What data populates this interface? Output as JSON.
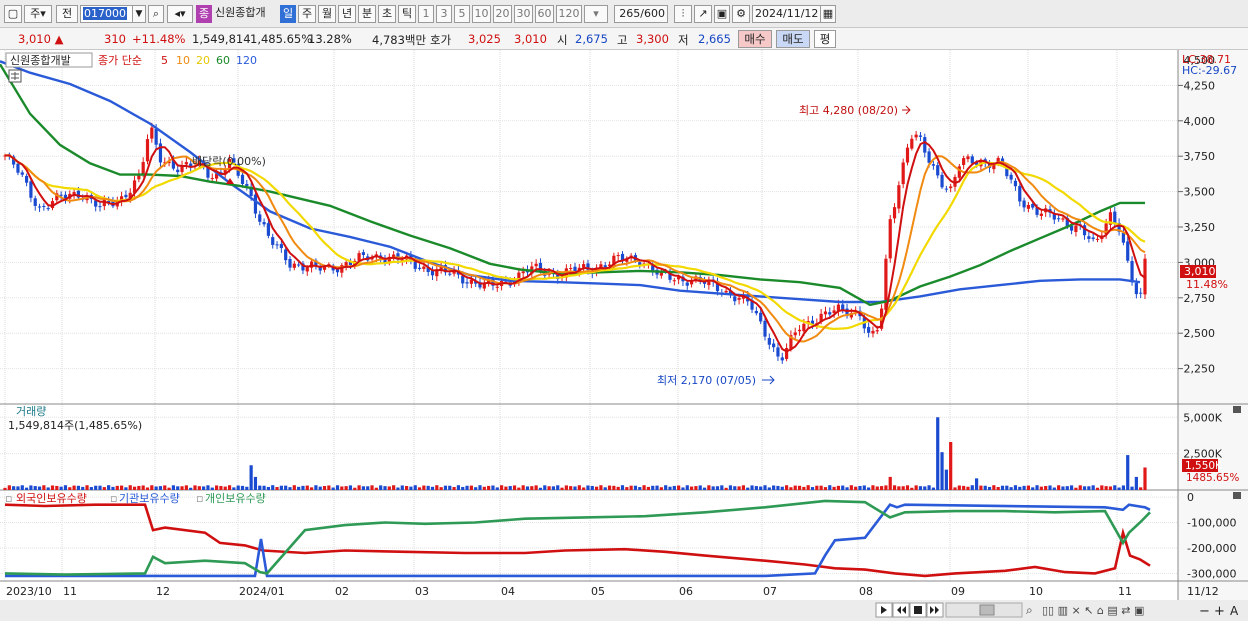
{
  "toolbar": {
    "mode_label": "주",
    "prev_label": "전",
    "code": "017000",
    "stock_name": "신원종합개",
    "period_tabs": [
      "일",
      "주",
      "월",
      "년",
      "분",
      "초",
      "틱"
    ],
    "intervals": [
      "1",
      "3",
      "5",
      "10",
      "20",
      "30",
      "60",
      "120"
    ],
    "count": "265",
    "count_max": "/600",
    "date": "2024/11/12",
    "jong_label": "종"
  },
  "quote": {
    "price": "3,010",
    "change": "310",
    "change_pct": "+11.48%",
    "volume": "1,549,814",
    "volume_pct": "1,485.65%",
    "turnover": "13.28%",
    "amount": "4,783백만",
    "hoga_label": "호가",
    "hoga_ask": "3,025",
    "hoga_bid": "3,010",
    "open_label": "시",
    "open": "2,675",
    "high_label": "고",
    "high": "3,300",
    "low_label": "저",
    "low": "2,665",
    "buy_label": "매수",
    "sell_label": "매도",
    "avg_label": "평"
  },
  "chart_data": [
    {
      "type": "candlestick",
      "title": "신원종합개발",
      "legend": {
        "label": "종가 단순",
        "items": [
          "5",
          "10",
          "20",
          "60",
          "120"
        ],
        "colors": [
          "#d01010",
          "#f08a10",
          "#f2d900",
          "#1a8a2a",
          "#2a5ad8"
        ]
      },
      "ylim": [
        2000,
        4500
      ],
      "yticks": [
        "2,250",
        "2,500",
        "2,750",
        "3,000",
        "3,250",
        "3,500",
        "3,750",
        "4,000",
        "4,250"
      ],
      "y_top_label": "4,500",
      "lc": "LC:38.71",
      "hc": "HC:-29.67",
      "current_price": "3,010",
      "current_pct": "11.48%",
      "annotations": {
        "high": "최고 4,280 (08/20)",
        "low": "최저 2,170 (07/05)",
        "dividend": "배당락(0.00%)"
      },
      "ma120": [
        [
          0,
          4420
        ],
        [
          30,
          4340
        ],
        [
          70,
          4260
        ],
        [
          110,
          4140
        ],
        [
          150,
          3980
        ],
        [
          190,
          3780
        ],
        [
          230,
          3560
        ],
        [
          270,
          3360
        ],
        [
          310,
          3240
        ],
        [
          350,
          3180
        ],
        [
          390,
          3110
        ],
        [
          430,
          3000
        ],
        [
          470,
          2910
        ],
        [
          510,
          2870
        ],
        [
          560,
          2860
        ],
        [
          600,
          2850
        ],
        [
          640,
          2840
        ],
        [
          680,
          2800
        ],
        [
          720,
          2780
        ],
        [
          760,
          2760
        ],
        [
          800,
          2740
        ],
        [
          840,
          2720
        ],
        [
          880,
          2720
        ],
        [
          920,
          2760
        ],
        [
          960,
          2810
        ],
        [
          1000,
          2840
        ],
        [
          1040,
          2870
        ],
        [
          1080,
          2880
        ],
        [
          1100,
          2880
        ],
        [
          1120,
          2880
        ],
        [
          1140,
          2860
        ]
      ],
      "ma60": [
        [
          0,
          4400
        ],
        [
          30,
          4050
        ],
        [
          60,
          3830
        ],
        [
          90,
          3700
        ],
        [
          120,
          3620
        ],
        [
          150,
          3620
        ],
        [
          180,
          3610
        ],
        [
          210,
          3570
        ],
        [
          240,
          3540
        ],
        [
          270,
          3500
        ],
        [
          300,
          3450
        ],
        [
          330,
          3400
        ],
        [
          370,
          3290
        ],
        [
          410,
          3190
        ],
        [
          450,
          3100
        ],
        [
          490,
          2990
        ],
        [
          520,
          2950
        ],
        [
          560,
          2920
        ],
        [
          600,
          2930
        ],
        [
          640,
          2940
        ],
        [
          680,
          2930
        ],
        [
          720,
          2910
        ],
        [
          760,
          2880
        ],
        [
          800,
          2860
        ],
        [
          840,
          2820
        ],
        [
          870,
          2700
        ],
        [
          890,
          2730
        ],
        [
          920,
          2830
        ],
        [
          950,
          2900
        ],
        [
          980,
          2980
        ],
        [
          1010,
          3080
        ],
        [
          1040,
          3170
        ],
        [
          1070,
          3260
        ],
        [
          1100,
          3360
        ],
        [
          1120,
          3420
        ],
        [
          1145,
          3420
        ]
      ]
    },
    {
      "type": "bar",
      "title": "거래량",
      "summary": "1,549,814주(1,485.65%)",
      "ylim": [
        0,
        5500000
      ],
      "yticks": [
        "2,500K",
        "5,000K"
      ],
      "current": "1,550K",
      "current_pct": "1485.65%"
    },
    {
      "type": "line",
      "legend": [
        "외국인보유수량",
        "기관보유수량",
        "개인보유수량"
      ],
      "colors": [
        "#d01010",
        "#2a5ad8",
        "#2e9a55"
      ],
      "ylim": [
        -330000,
        20000
      ],
      "yticks": [
        "0",
        "-100,000",
        "-200,000",
        "-300,000"
      ],
      "series": [
        {
          "name": "외국인보유수량",
          "points": [
            [
              0,
              -30000
            ],
            [
              40,
              -35000
            ],
            [
              90,
              -30000
            ],
            [
              140,
              -30000
            ],
            [
              148,
              -130000
            ],
            [
              160,
              -120000
            ],
            [
              200,
              -140000
            ],
            [
              215,
              -180000
            ],
            [
              240,
              -190000
            ],
            [
              258,
              -210000
            ],
            [
              300,
              -220000
            ],
            [
              340,
              -210000
            ],
            [
              400,
              -215000
            ],
            [
              460,
              -220000
            ],
            [
              520,
              -220000
            ],
            [
              560,
              -210000
            ],
            [
              620,
              -205000
            ],
            [
              660,
              -215000
            ],
            [
              700,
              -230000
            ],
            [
              760,
              -250000
            ],
            [
              800,
              -265000
            ],
            [
              830,
              -280000
            ],
            [
              860,
              -285000
            ],
            [
              890,
              -300000
            ],
            [
              920,
              -310000
            ],
            [
              950,
              -300000
            ],
            [
              1000,
              -290000
            ],
            [
              1030,
              -275000
            ],
            [
              1060,
              -295000
            ],
            [
              1090,
              -300000
            ],
            [
              1110,
              -280000
            ],
            [
              1118,
              -140000
            ],
            [
              1125,
              -230000
            ],
            [
              1135,
              -245000
            ],
            [
              1145,
              -270000
            ]
          ]
        },
        {
          "name": "기관보유수량",
          "points": [
            [
              0,
              -310000
            ],
            [
              250,
              -310000
            ],
            [
              256,
              -165000
            ],
            [
              262,
              -310000
            ],
            [
              500,
              -310000
            ],
            [
              600,
              -310000
            ],
            [
              760,
              -310000
            ],
            [
              810,
              -300000
            ],
            [
              820,
              -230000
            ],
            [
              830,
              -170000
            ],
            [
              860,
              -160000
            ],
            [
              885,
              -30000
            ],
            [
              892,
              -40000
            ],
            [
              900,
              -30000
            ],
            [
              1100,
              -40000
            ],
            [
              1118,
              -50000
            ],
            [
              1124,
              -30000
            ],
            [
              1140,
              -40000
            ],
            [
              1145,
              -50000
            ]
          ]
        },
        {
          "name": "개인보유수량",
          "points": [
            [
              0,
              -300000
            ],
            [
              60,
              -305000
            ],
            [
              140,
              -300000
            ],
            [
              148,
              -235000
            ],
            [
              160,
              -260000
            ],
            [
              200,
              -250000
            ],
            [
              240,
              -260000
            ],
            [
              255,
              -295000
            ],
            [
              262,
              -300000
            ],
            [
              300,
              -130000
            ],
            [
              340,
              -110000
            ],
            [
              380,
              -100000
            ],
            [
              420,
              -105000
            ],
            [
              470,
              -100000
            ],
            [
              520,
              -85000
            ],
            [
              580,
              -80000
            ],
            [
              640,
              -75000
            ],
            [
              700,
              -60000
            ],
            [
              760,
              -40000
            ],
            [
              820,
              -15000
            ],
            [
              860,
              -20000
            ],
            [
              885,
              -80000
            ],
            [
              900,
              -60000
            ],
            [
              950,
              -55000
            ],
            [
              1000,
              -55000
            ],
            [
              1050,
              -60000
            ],
            [
              1100,
              -55000
            ],
            [
              1118,
              -180000
            ],
            [
              1124,
              -140000
            ],
            [
              1135,
              -100000
            ],
            [
              1145,
              -60000
            ]
          ]
        }
      ]
    }
  ],
  "xaxis": {
    "labels": [
      "2023/10",
      "11",
      "12",
      "2024/01",
      "02",
      "03",
      "04",
      "05",
      "06",
      "07",
      "08",
      "09",
      "10",
      "11"
    ],
    "end_label": "11/12"
  }
}
